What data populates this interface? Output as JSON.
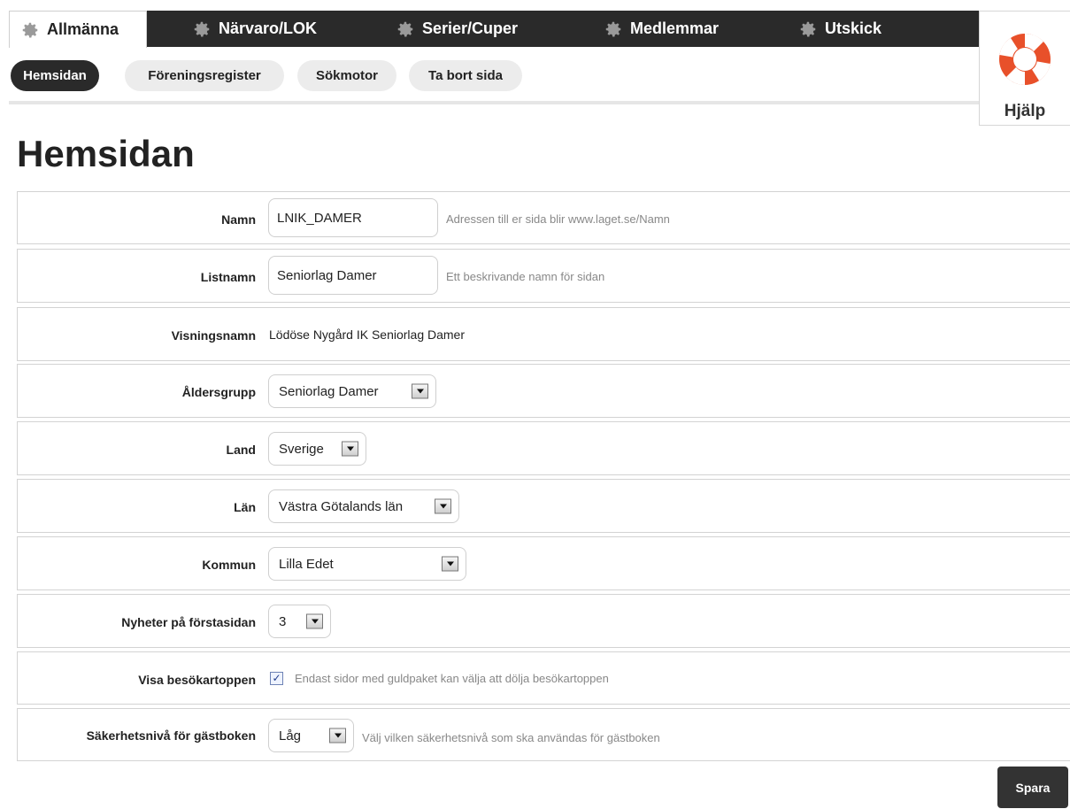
{
  "nav": {
    "tabs": [
      {
        "label": "Allmänna",
        "icon": "gear-icon",
        "active": true
      },
      {
        "label": "Närvaro/LOK",
        "icon": "gear-icon"
      },
      {
        "label": "Serier/Cuper",
        "icon": "gear-icon"
      },
      {
        "label": "Medlemmar",
        "icon": "gear-icon"
      },
      {
        "label": "Utskick",
        "icon": "gear-icon"
      }
    ],
    "subtabs": [
      {
        "label": "Hemsidan",
        "active": true
      },
      {
        "label": "Föreningsregister"
      },
      {
        "label": "Sökmotor"
      },
      {
        "label": "Ta bort sida"
      }
    ]
  },
  "help": {
    "label": "Hjälp",
    "icon": "lifebuoy-icon"
  },
  "page_title": "Hemsidan",
  "form": {
    "namn": {
      "label": "Namn",
      "value": "LNIK_DAMER",
      "hint": "Adressen till er sida blir www.laget.se/Namn"
    },
    "listnamn": {
      "label": "Listnamn",
      "value": "Seniorlag Damer",
      "hint": "Ett beskrivande namn för sidan"
    },
    "visningsnamn": {
      "label": "Visningsnamn",
      "value": "Lödöse Nygård IK Seniorlag Damer"
    },
    "aldersgrupp": {
      "label": "Åldersgrupp",
      "value": "Seniorlag Damer"
    },
    "land": {
      "label": "Land",
      "value": "Sverige"
    },
    "lan": {
      "label": "Län",
      "value": "Västra Götalands län"
    },
    "kommun": {
      "label": "Kommun",
      "value": "Lilla Edet"
    },
    "nyheter": {
      "label": "Nyheter på förstasidan",
      "value": "3"
    },
    "besokartoppen": {
      "label": "Visa besökartoppen",
      "checked": true,
      "hint": "Endast sidor med guldpaket kan välja att dölja besökartoppen"
    },
    "sakerhet": {
      "label": "Säkerhetsnivå för gästboken",
      "value": "Låg",
      "hint": "Välj vilken säkerhetsnivå som ska användas för gästboken"
    }
  },
  "save_label": "Spara",
  "colors": {
    "nav_bg": "#2a2a2a",
    "pill_bg": "#ececec",
    "border": "#d3d3d3",
    "accent_red": "#e8502a"
  }
}
